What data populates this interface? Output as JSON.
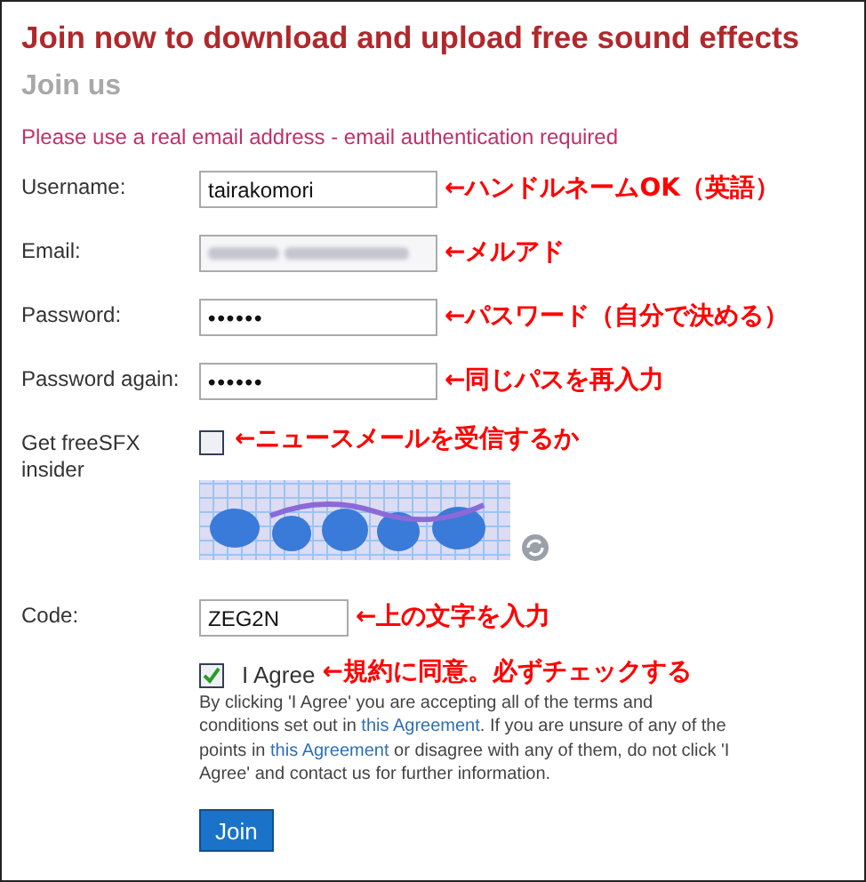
{
  "title": "Join now to download and upload free sound effects",
  "subtitle": "Join us",
  "notice": "Please use a real email address - email authentication required",
  "fields": [
    {
      "kind": "text",
      "label": "Username:",
      "value": "tairakomori",
      "note": "←ハンドルネームOK（英語）"
    },
    {
      "kind": "blurred",
      "label": "Email:",
      "note": "←メルアド"
    },
    {
      "kind": "password",
      "label": "Password:",
      "value": "••••••",
      "note": "←パスワード（自分で決める）"
    },
    {
      "kind": "password",
      "label": "Password again:",
      "value": "••••••",
      "note": "←同じパスを再入力"
    },
    {
      "kind": "checkbox",
      "label": "Get freeSFX insider",
      "checked": false,
      "note": "←ニュースメールを受信するか"
    }
  ],
  "code": {
    "label": "Code:",
    "value": "ZEG2N",
    "note": "←上の文字を入力"
  },
  "agree": {
    "label": "I Agree",
    "checked": true,
    "note": "←規約に同意。必ずチェックする"
  },
  "terms": [
    {
      "kind": "text",
      "text": "By clicking 'I Agree' you are accepting all of the terms and conditions set out in "
    },
    {
      "kind": "link",
      "text": "this Agreement"
    },
    {
      "kind": "text",
      "text": ". If you are unsure of any of the points in "
    },
    {
      "kind": "link",
      "text": "this Agreement"
    },
    {
      "kind": "text",
      "text": " or disagree with any of them, do not click 'I Agree' and contact us for further information."
    }
  ],
  "button": "Join"
}
